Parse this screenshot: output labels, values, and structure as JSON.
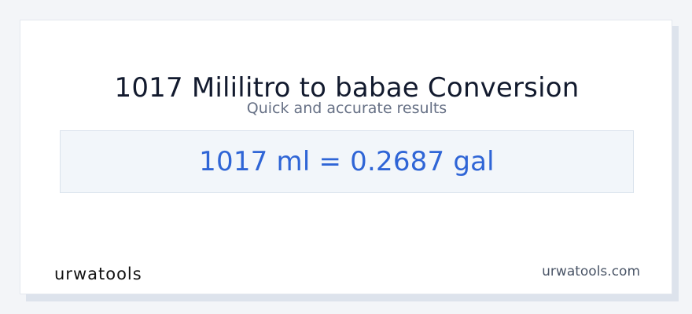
{
  "conversion": {
    "title": "1017 Mililitro to babae Conversion",
    "subtitle": "Quick and accurate results",
    "result": "1017 ml = 0.2687 gal"
  },
  "footer": {
    "logo_text": "urwatools",
    "domain": "urwatools.com"
  },
  "colors": {
    "title": "#121a2e",
    "subtitle": "#667085",
    "result": "#2f65d6",
    "result_background": "#f2f6fa",
    "page_background": "#f3f5f8"
  }
}
